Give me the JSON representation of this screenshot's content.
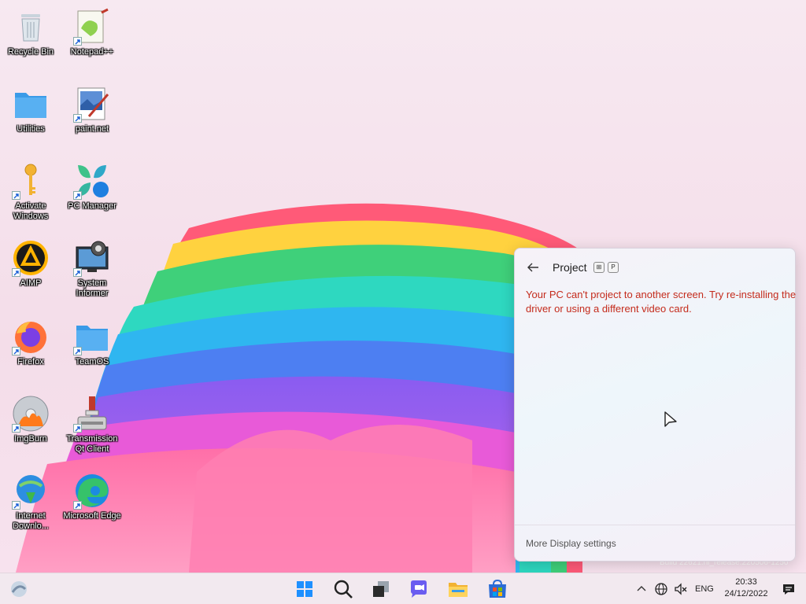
{
  "desktop": {
    "icons": [
      {
        "label": "Recycle Bin"
      },
      {
        "label": "Notepad++"
      },
      {
        "label": "Utilities"
      },
      {
        "label": "paint.net"
      },
      {
        "label": "Activate Windows"
      },
      {
        "label": "PC Manager"
      },
      {
        "label": "AIMP"
      },
      {
        "label": "System Informer"
      },
      {
        "label": "Firefox"
      },
      {
        "label": "TeamOS"
      },
      {
        "label": "ImgBurn"
      },
      {
        "label": "Transmission Qt Client"
      },
      {
        "label": "Internet Downlo..."
      },
      {
        "label": "Microsoft Edge"
      }
    ],
    "build_text": "Build 22621.ni_release.220506-1250"
  },
  "project_panel": {
    "title": "Project",
    "shortcut_keys": [
      "⊞",
      "P"
    ],
    "error_message": "Your PC can't project to another screen. Try re-installing the driver or using a different video card.",
    "more_link": "More Display settings",
    "error_color": "#c42b1c"
  },
  "taskbar": {
    "apps": [
      "widgets-icon",
      "start-icon",
      "search-icon",
      "task-view-icon",
      "chat-icon",
      "file-explorer-icon",
      "store-icon"
    ],
    "tray": {
      "language": "ENG",
      "time": "20:33",
      "date": "24/12/2022"
    }
  }
}
